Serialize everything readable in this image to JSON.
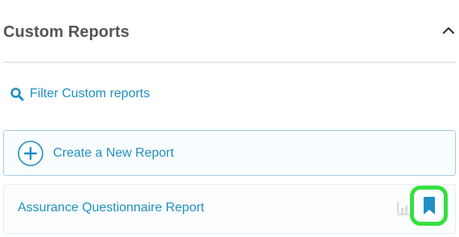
{
  "header": {
    "title": "Custom Reports"
  },
  "filter": {
    "label": "Filter Custom reports"
  },
  "create": {
    "label": "Create a New Report"
  },
  "reports": [
    {
      "label": "Assurance Questionnaire Report"
    }
  ],
  "icons": {
    "collapse": "chevron-up-icon",
    "filter": "search-icon",
    "create": "plus-circle-icon",
    "report_chart": "bar-chart-icon",
    "bookmark": "bookmark-icon"
  },
  "colors": {
    "accent": "#1f8fc4",
    "highlight": "#35e03f",
    "title": "#555555"
  }
}
